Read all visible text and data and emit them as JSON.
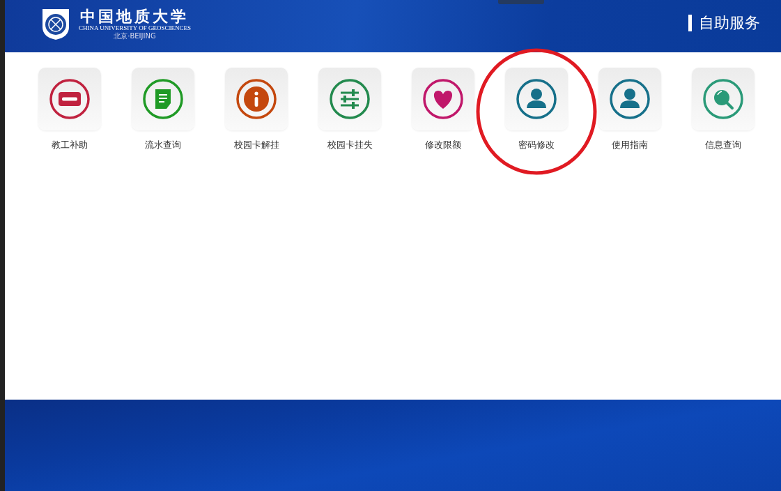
{
  "header": {
    "logo_title": "中国地质大学",
    "logo_subtitle": "CHINA UNIVERSITY OF GEOSCIENCES",
    "logo_city": "北京·BEIJING",
    "section_title": "自助服务"
  },
  "services": [
    {
      "label": "教工补助",
      "kind": "minus",
      "color": "#c0223f",
      "circled": false
    },
    {
      "label": "流水查询",
      "kind": "document",
      "color": "#1f9a25",
      "circled": false
    },
    {
      "label": "校园卡解挂",
      "kind": "info",
      "color": "#c4480e",
      "circled": false
    },
    {
      "label": "校园卡挂失",
      "kind": "sliders",
      "color": "#238a4e",
      "circled": false
    },
    {
      "label": "修改限额",
      "kind": "heart",
      "color": "#c0176a",
      "circled": false
    },
    {
      "label": "密码修改",
      "kind": "user",
      "color": "#16708a",
      "circled": true
    },
    {
      "label": "使用指南",
      "kind": "user",
      "color": "#16708a",
      "circled": false
    },
    {
      "label": "信息查询",
      "kind": "search",
      "color": "#2a9a78",
      "circled": false
    }
  ]
}
